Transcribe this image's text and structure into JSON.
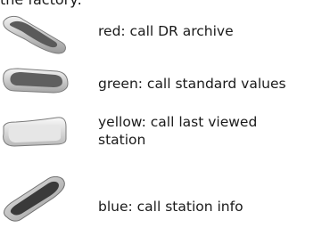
{
  "header": {
    "text": "the factory:"
  },
  "keys": [
    {
      "color": "#d9453d",
      "label": "red: call DR archive",
      "icon": "red-remote-key-icon"
    },
    {
      "color": "#3fa84f",
      "label": "green: call standard values",
      "icon": "green-remote-key-icon"
    },
    {
      "color": "#e8d44d",
      "label": "yellow: call last viewed station",
      "icon": "yellow-remote-key-icon"
    },
    {
      "color": "#3b6fc4",
      "label": "blue: call station info",
      "icon": "blue-remote-key-icon"
    }
  ]
}
